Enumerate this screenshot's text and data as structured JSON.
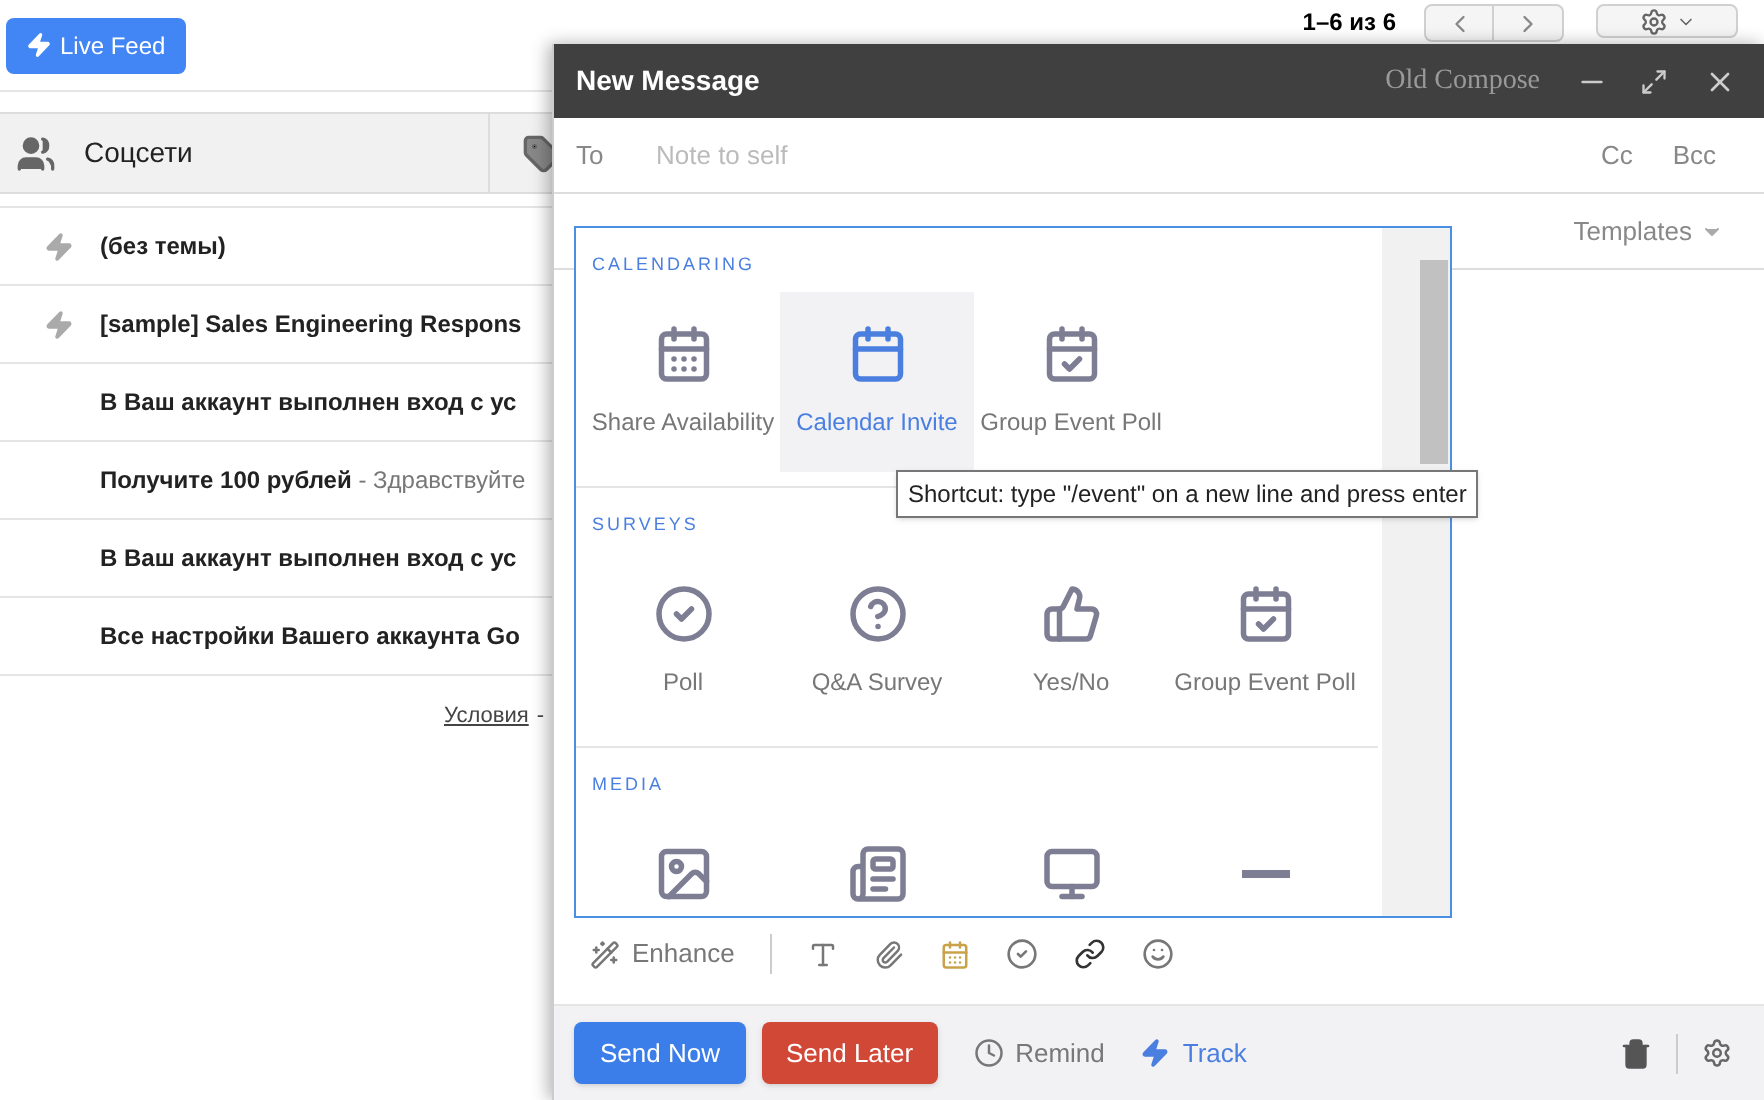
{
  "page": {
    "live_feed_button": "Live Feed",
    "count": "1–6 из 6",
    "tab": {
      "label": "Соцсети"
    },
    "emails": [
      {
        "subject": "(без темы)",
        "tracked": true
      },
      {
        "subject": "[sample] Sales Engineering Respons",
        "tracked": true
      },
      {
        "subject": "В Ваш аккаунт выполнен вход с ус",
        "tracked": false
      },
      {
        "subject": "Получите 100 рублей",
        "snippet": " - Здравствуйте",
        "tracked": false
      },
      {
        "subject": "В Ваш аккаунт выполнен вход с ус",
        "tracked": false
      },
      {
        "subject": "Все настройки Вашего аккаунта Go",
        "tracked": false
      }
    ],
    "footer_link": "Условия",
    "footer_separator": "-"
  },
  "compose": {
    "title": "New Message",
    "old_compose": "Old Compose",
    "to_label": "To",
    "to_placeholder": "Note to self",
    "cc": "Cc",
    "bcc": "Bcc",
    "templates": "Templates",
    "sections": [
      {
        "title": "CALENDARING",
        "items": [
          {
            "kind": "calendar-grid",
            "label": "Share Availability",
            "selected": false
          },
          {
            "kind": "calendar",
            "label": "Calendar Invite",
            "selected": true
          },
          {
            "kind": "calendar-check",
            "label": "Group Event Poll",
            "selected": false
          }
        ]
      },
      {
        "title": "SURVEYS",
        "items": [
          {
            "kind": "check-circle",
            "label": "Poll",
            "selected": false
          },
          {
            "kind": "question",
            "label": "Q&A Survey",
            "selected": false
          },
          {
            "kind": "thumbs-up",
            "label": "Yes/No",
            "selected": false
          },
          {
            "kind": "calendar-check",
            "label": "Group Event Poll",
            "selected": false
          }
        ]
      },
      {
        "title": "MEDIA",
        "items": [
          {
            "kind": "image",
            "selected": false
          },
          {
            "kind": "newspaper",
            "selected": false
          },
          {
            "kind": "monitor",
            "selected": false
          },
          {
            "kind": "minus",
            "selected": false
          }
        ]
      }
    ],
    "tooltip": "Shortcut: type \"/event\" on a new line and press enter",
    "enhance": "Enhance",
    "send_now": "Send Now",
    "send_later": "Send Later",
    "remind": "Remind",
    "track": "Track"
  }
}
